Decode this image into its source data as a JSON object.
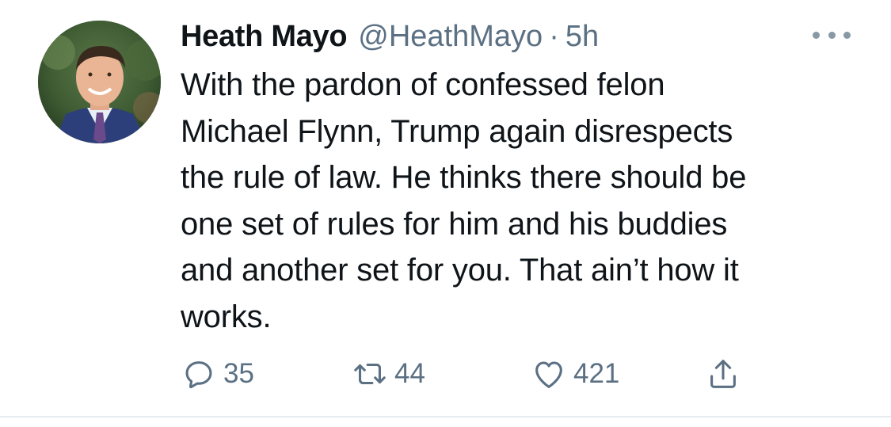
{
  "tweet": {
    "author_name": "Heath Mayo",
    "handle": "@HeathMayo",
    "separator": "·",
    "time": "5h",
    "text_lines": [
      "With the pardon of confessed felon",
      "Michael Flynn, Trump again disrespects",
      "the rule of law. He thinks there should be",
      "one set of rules for him and his buddies",
      "and another set for you. That ain’t how it",
      "works."
    ],
    "actions": {
      "reply_count": "35",
      "retweet_count": "44",
      "like_count": "421"
    }
  },
  "icons": {
    "more": "more-horizontal-icon",
    "reply": "reply-icon",
    "retweet": "retweet-icon",
    "like": "heart-icon",
    "share": "share-icon"
  },
  "colors": {
    "text": "#0f1419",
    "secondary": "#5b7083",
    "divider": "#e6ecf0"
  }
}
